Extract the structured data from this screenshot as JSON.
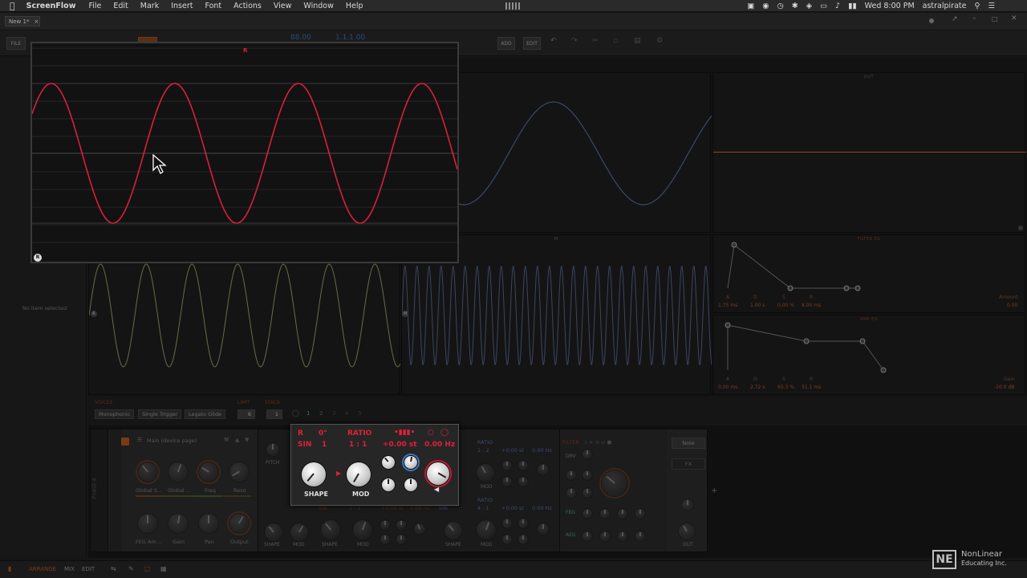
{
  "menubar": {
    "app": "ScreenFlow",
    "items": [
      "File",
      "Edit",
      "Mark",
      "Insert",
      "Font",
      "Actions",
      "View",
      "Window",
      "Help"
    ],
    "clock": "Wed 8:00 PM",
    "user": "astralpirate"
  },
  "appbar": {
    "tab": "New 1*",
    "tab_close": "×"
  },
  "toolbar": {
    "file_label": "FILE",
    "tempo": "88.00",
    "position": "1.1.1.00",
    "add_label": "ADD",
    "edit_label": "EDIT"
  },
  "leftpanel": {
    "empty_text": "No item selected"
  },
  "editor": {
    "panels": {
      "s_title": "S",
      "out_title": "OUT",
      "m_title": "M",
      "filter_eg_title": "FILTER EG",
      "amp_eg_title": "AMP EG"
    },
    "filter_eg": {
      "labels": [
        "A",
        "D",
        "S",
        "R"
      ],
      "values": [
        "1.75 ms",
        "1.00 s",
        "0.00 %",
        "8.00 ms"
      ],
      "amount_label": "Amount",
      "amount_value": "0.00"
    },
    "amp_eg": {
      "labels": [
        "A",
        "D",
        "S",
        "R"
      ],
      "values": [
        "0.00 ms",
        "2.72 s",
        "65.3 %",
        "51.1 ms"
      ],
      "gain_label": "Gain",
      "gain_value": "-10.0 dB"
    },
    "osc_markers": [
      "R",
      "M"
    ]
  },
  "voices": {
    "voices_label": "VOICES",
    "limit_label": "LIMIT",
    "stack_label": "STACK",
    "modes": [
      "Monophonic",
      "Single Trigger",
      "Legato Glide"
    ],
    "limit_value": "6",
    "stack_value": "1",
    "stack_options": [
      "1",
      "2",
      "3",
      "4",
      "5"
    ]
  },
  "device": {
    "side_label": "PHASE-4",
    "preset": "Main (device page)",
    "knob_labels": [
      "Global S...",
      "Global ...",
      "Freq",
      "Reso",
      "FEG Am...",
      "Gain",
      "Pan",
      "Output"
    ],
    "pitch_label": "PITCH",
    "ratio_label": "RATIO",
    "sin_label": "SIN",
    "ratio_value": "1 : 2",
    "ratio_value_b": "1 : 2",
    "ratio_value_c": "4 : 1",
    "st_value": "+0.00 st",
    "hz_value": "0.00 Hz",
    "shape_label": "SHAPE",
    "mod_label": "MOD",
    "filter_label": "FILTER",
    "drv_label": "DRV",
    "feg_label": "FEG",
    "aeg_label": "AEG",
    "note_tab": "Note",
    "fx_tab": "FX",
    "out_label": "OUT",
    "plus": "+"
  },
  "popup": {
    "marker_top": "R",
    "marker_bottom": "R",
    "wave_color": "#d8203c"
  },
  "osc_panel": {
    "r_label": "R",
    "phase_value": "0°",
    "ratio_label": "RATIO",
    "sin_label": "SIN",
    "sin_value": "1",
    "ratio_value": "1 : 1",
    "st_value": "+0.00 st",
    "hz_value": "0.00 Hz",
    "shape_label": "SHAPE",
    "mod_label": "MOD"
  },
  "bottombar": {
    "arrange": "ARRANGE",
    "mix": "MIX",
    "edit": "EDIT"
  },
  "watermark": {
    "logo": "NE",
    "line1": "NonLinear",
    "line2": "Educating Inc."
  },
  "colors": {
    "accent_red": "#d8203c",
    "accent_orange": "#c0501c",
    "wave_blue": "#3a4a66",
    "wave_yellow": "#6a6a4a"
  }
}
